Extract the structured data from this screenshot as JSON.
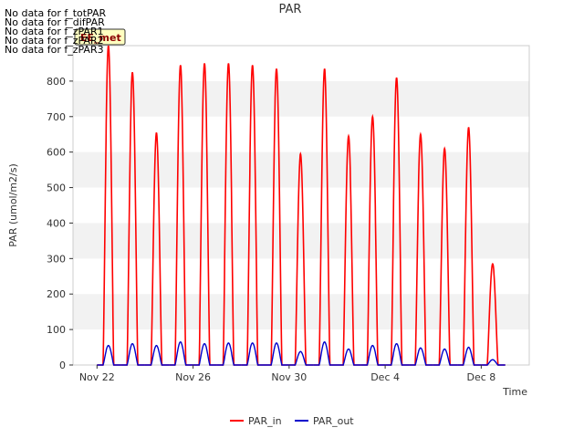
{
  "chart_data": {
    "type": "line",
    "title": "PAR",
    "xlabel": "Time",
    "ylabel": "PAR (umol/m2/s)",
    "ylim": [
      0,
      900
    ],
    "y_ticks": [
      0,
      100,
      200,
      300,
      400,
      500,
      600,
      700,
      800
    ],
    "x_range": [
      "Nov 21",
      "Dec 10"
    ],
    "x_ticks": [
      {
        "label": "Nov 22",
        "day": 22
      },
      {
        "label": "Nov 26",
        "day": 26
      },
      {
        "label": "Nov 30",
        "day": 30
      },
      {
        "label": "Dec 4",
        "day": 34
      },
      {
        "label": "Dec 8",
        "day": 38
      }
    ],
    "grid": "horizontal alternating bands",
    "legend": "bottom-center",
    "no_data_messages": [
      "No data for f_totPAR",
      "No data for f_difPAR",
      "No data for f_zPAR1",
      "No data for f_zPAR2",
      "No data for f_zPAR3"
    ],
    "badge": "EE_met",
    "series": [
      {
        "name": "PAR_in",
        "color": "#ff0000",
        "daily_peaks": [
          {
            "date": "Nov 22",
            "peak": 900
          },
          {
            "date": "Nov 23",
            "peak": 825
          },
          {
            "date": "Nov 24",
            "peak": 655
          },
          {
            "date": "Nov 25",
            "peak": 845
          },
          {
            "date": "Nov 26",
            "peak": 850
          },
          {
            "date": "Nov 27",
            "peak": 850
          },
          {
            "date": "Nov 28",
            "peak": 845
          },
          {
            "date": "Nov 29",
            "peak": 835
          },
          {
            "date": "Nov 30",
            "peak": 595
          },
          {
            "date": "Dec 1",
            "peak": 835
          },
          {
            "date": "Dec 2",
            "peak": 645
          },
          {
            "date": "Dec 3",
            "peak": 700
          },
          {
            "date": "Dec 4",
            "peak": 810
          },
          {
            "date": "Dec 5",
            "peak": 650
          },
          {
            "date": "Dec 6",
            "peak": 610
          },
          {
            "date": "Dec 7",
            "peak": 670
          },
          {
            "date": "Dec 8",
            "peak": 285
          }
        ]
      },
      {
        "name": "PAR_out",
        "color": "#0000cc",
        "daily_peaks": [
          {
            "date": "Nov 22",
            "peak": 55
          },
          {
            "date": "Nov 23",
            "peak": 60
          },
          {
            "date": "Nov 24",
            "peak": 55
          },
          {
            "date": "Nov 25",
            "peak": 65
          },
          {
            "date": "Nov 26",
            "peak": 60
          },
          {
            "date": "Nov 27",
            "peak": 62
          },
          {
            "date": "Nov 28",
            "peak": 62
          },
          {
            "date": "Nov 29",
            "peak": 62
          },
          {
            "date": "Nov 30",
            "peak": 38
          },
          {
            "date": "Dec 1",
            "peak": 65
          },
          {
            "date": "Dec 2",
            "peak": 45
          },
          {
            "date": "Dec 3",
            "peak": 55
          },
          {
            "date": "Dec 4",
            "peak": 60
          },
          {
            "date": "Dec 5",
            "peak": 48
          },
          {
            "date": "Dec 6",
            "peak": 45
          },
          {
            "date": "Dec 7",
            "peak": 50
          },
          {
            "date": "Dec 8",
            "peak": 15
          }
        ]
      }
    ]
  }
}
